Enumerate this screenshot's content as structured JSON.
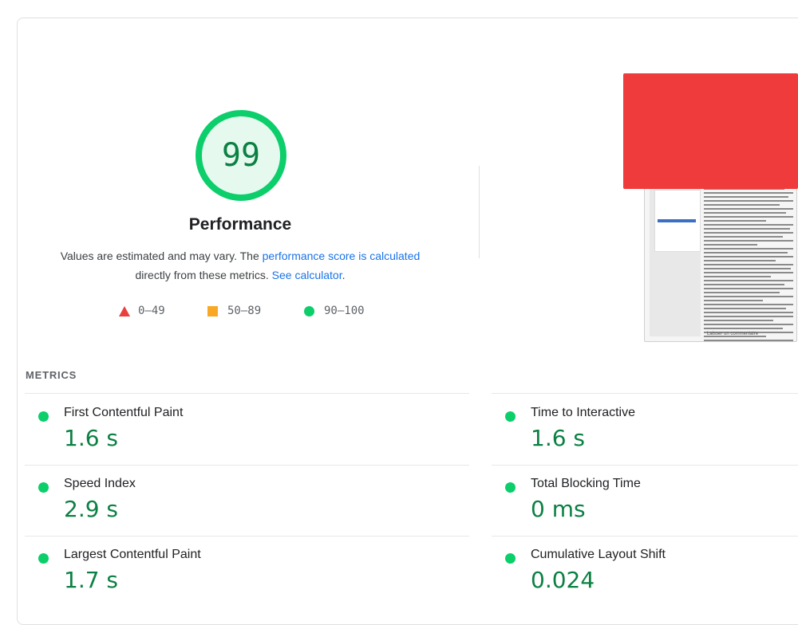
{
  "score": {
    "value": "99",
    "title": "Performance",
    "fraction": 0.99,
    "ring_color": "#0cce6b",
    "text_color": "#0b8043"
  },
  "description": {
    "text1": "Values are estimated and may vary. The ",
    "link1": "performance score is calculated",
    "text2": "directly from these metrics. ",
    "link2": "See calculator",
    "text3": "."
  },
  "legend": [
    {
      "icon": "triangle-fail-icon",
      "label": "0–49",
      "color": "#ea3f3f"
    },
    {
      "icon": "square-average-icon",
      "label": "50–89",
      "color": "#f9a825"
    },
    {
      "icon": "circle-pass-icon",
      "label": "90–100",
      "color": "#0cce6b"
    }
  ],
  "thumbnail": {
    "footer": "Laisser un commentaire",
    "redaction_color": "#ef3b3b"
  },
  "metrics": {
    "title": "METRICS",
    "items": [
      {
        "label": "First Contentful Paint",
        "value": "1.6 s"
      },
      {
        "label": "Time to Interactive",
        "value": "1.6 s"
      },
      {
        "label": "Speed Index",
        "value": "2.9 s"
      },
      {
        "label": "Total Blocking Time",
        "value": "0 ms"
      },
      {
        "label": "Largest Contentful Paint",
        "value": "1.7 s"
      },
      {
        "label": "Cumulative Layout Shift",
        "value": "0.024"
      }
    ]
  }
}
